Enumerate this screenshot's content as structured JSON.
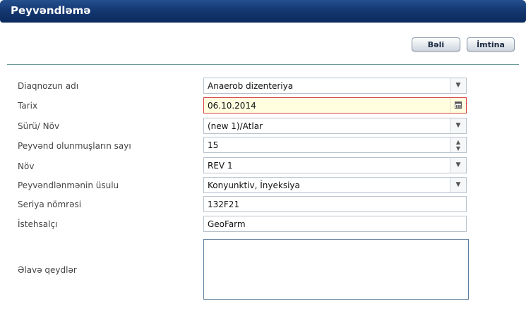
{
  "window": {
    "title": "Peyvəndləmə"
  },
  "actions": {
    "ok_label": "Bəli",
    "cancel_label": "İmtina"
  },
  "form": {
    "diagnosis": {
      "label": "Diaqnozun adı",
      "value": "Anaerob dizenteriya"
    },
    "date": {
      "label": "Tarix",
      "value": "06.10.2014"
    },
    "herd": {
      "label": "Sürü/ Növ",
      "value": "(new 1)/Atlar"
    },
    "vaccinated_count": {
      "label": "Peyvənd olunmuşların sayı",
      "value": "15"
    },
    "type": {
      "label": "Növ",
      "value": "REV 1"
    },
    "method": {
      "label": "Peyvəndlənmənin üsulu",
      "value": "Konyunktiv, İnyeksiya"
    },
    "serial": {
      "label": "Seriya nömrəsi",
      "value": "132F21"
    },
    "manufacturer": {
      "label": "İstehsalçı",
      "value": "GeoFarm"
    },
    "notes": {
      "label": "Əlavə qeydlər",
      "value": ""
    }
  },
  "icons": {
    "dropdown": "chevron-down-icon",
    "calendar": "calendar-icon",
    "spinner": "spinner-icon"
  },
  "colors": {
    "titlebar": "#143872",
    "date_field_background": "#ffffe0",
    "date_field_border": "#d9413d",
    "divider": "#6a9a9a"
  }
}
